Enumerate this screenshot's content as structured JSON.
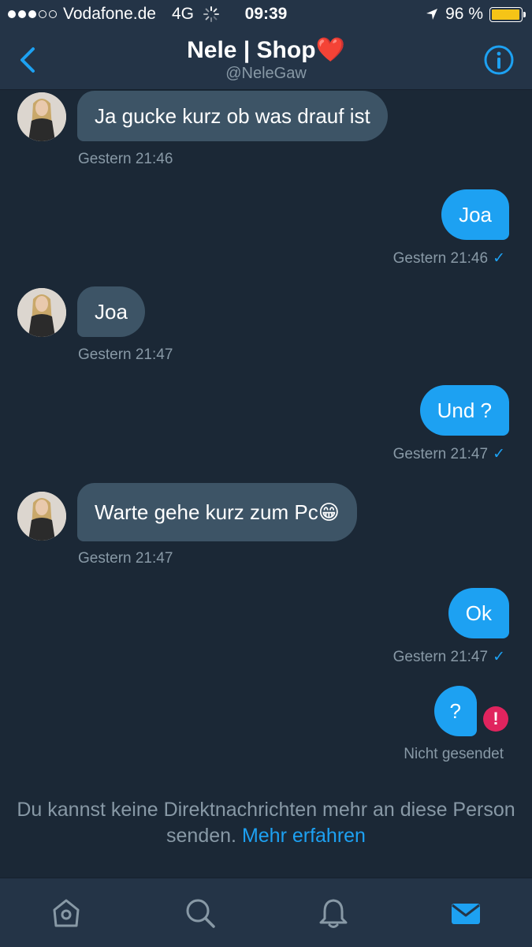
{
  "status_bar": {
    "carrier": "Vodafone.de",
    "network": "4G",
    "time": "09:39",
    "battery_text": "96 %",
    "battery_level": 0.96
  },
  "header": {
    "title": "Nele | Shop",
    "title_emoji": "❤️",
    "handle": "@NeleGaw",
    "back_icon": "chevron-left-icon",
    "info_icon": "info-icon"
  },
  "messages": [
    {
      "direction": "in",
      "text": "Ja gucke kurz ob was drauf ist",
      "time": "Gestern 21:46"
    },
    {
      "direction": "out",
      "text": "Joa",
      "time": "Gestern 21:46",
      "status": "✓"
    },
    {
      "direction": "in",
      "text": "Joa",
      "time": "Gestern 21:47"
    },
    {
      "direction": "out",
      "text": "Und ?",
      "time": "Gestern 21:47",
      "status": "✓"
    },
    {
      "direction": "in",
      "text": "Warte gehe kurz zum Pc😁",
      "time": "Gestern 21:47"
    },
    {
      "direction": "out",
      "text": "Ok",
      "time": "Gestern 21:47",
      "status": "✓"
    },
    {
      "direction": "out",
      "text": "?",
      "time": "Nicht gesendet",
      "error": "!"
    }
  ],
  "notice": {
    "text": "Du kannst keine Direktnachrichten mehr an diese Person senden.",
    "link": "Mehr erfahren"
  },
  "tabbar": {
    "tabs": [
      "home-icon",
      "search-icon",
      "notifications-icon",
      "messages-icon"
    ],
    "active": "messages-icon"
  },
  "colors": {
    "background": "#1b2836",
    "bar": "#243447",
    "incoming_bubble": "#3d5466",
    "outgoing_bubble": "#1da1f2",
    "error": "#e0245e",
    "muted_text": "#8899a6"
  }
}
